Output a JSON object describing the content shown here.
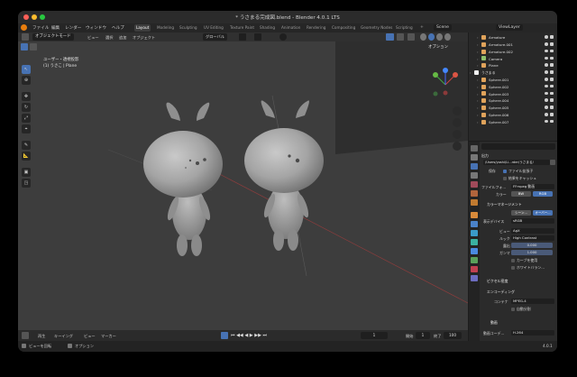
{
  "window": {
    "title": "* うさまる完成図.blend - Blender 4.0.1 LTS"
  },
  "menu": {
    "items": [
      "ファイル",
      "編集",
      "レンダー",
      "ウィンドウ",
      "ヘルプ"
    ]
  },
  "workspaces": {
    "tabs": [
      "Layout",
      "Modeling",
      "Sculpting",
      "UV Editing",
      "Texture Paint",
      "Shading",
      "Animation",
      "Rendering",
      "Compositing",
      "Geometry Nodes",
      "Scripting"
    ],
    "active": "Layout"
  },
  "scene_selector": {
    "scene": "Scene",
    "view_layer": "ViewLayer"
  },
  "viewport_header": {
    "mode": "オブジェクトモード",
    "menu_items": [
      "ビュー",
      "選択",
      "追加",
      "オブジェクト"
    ],
    "transform_orientation": "グローバル",
    "options_label": "オプション"
  },
  "viewport": {
    "view_name": "ユーザー・透視投影",
    "collection_path": "(1) うさこ | Plane"
  },
  "outliner": {
    "rows": [
      {
        "name": "Armature",
        "color": "#e0a35b",
        "indent": 1
      },
      {
        "name": "Armature.001",
        "color": "#e0a35b",
        "indent": 1
      },
      {
        "name": "Armature.002",
        "color": "#e0a35b",
        "indent": 1
      },
      {
        "name": "Camera",
        "color": "#8ec06c",
        "indent": 1
      },
      {
        "name": "Plane",
        "color": "#e0a35b",
        "indent": 1
      },
      {
        "name": "うさまる",
        "color": "#f2f2f2",
        "indent": 0
      },
      {
        "name": "Sphere.001",
        "color": "#e0a35b",
        "indent": 1
      },
      {
        "name": "Sphere.002",
        "color": "#e0a35b",
        "indent": 1
      },
      {
        "name": "Sphere.003",
        "color": "#e0a35b",
        "indent": 1
      },
      {
        "name": "Sphere.004",
        "color": "#e0a35b",
        "indent": 1
      },
      {
        "name": "Sphere.005",
        "color": "#e0a35b",
        "indent": 1
      },
      {
        "name": "Sphere.006",
        "color": "#e0a35b",
        "indent": 1
      },
      {
        "name": "Sphere.007",
        "color": "#e0a35b",
        "indent": 1
      }
    ]
  },
  "properties": {
    "output_section": "出力",
    "output_path": "/Users/yoshi/Li...rder/うさまる/",
    "save_label": "保存",
    "file_extension": "ファイル拡張子",
    "cache_result": "結果をキャッシュ",
    "file_format_label": "ファイルフォ...",
    "file_format_value": "FFmpeg 動画",
    "color_label": "カラー",
    "color_bw": "BW",
    "color_rgb": "RGB",
    "color_mgmt_section": "カラーマネージメント",
    "follow_scene": "シーン...",
    "override": "オーバー...",
    "display_device_label": "表示デバイス",
    "display_device_value": "sRGB",
    "view_label": "ビュー",
    "view_value": "AgX",
    "look_label": "ルック",
    "look_value": "High Contrast",
    "exposure_label": "露出",
    "exposure_value": "0.000",
    "gamma_label": "ガンマ",
    "gamma_value": "1.000",
    "use_curves": "カーブを使用",
    "white_balance": "ホワイトバラン...",
    "pixel_density_section": "ピクセル密度",
    "encoding_section": "エンコーディング",
    "container_label": "コンテナ",
    "container_value": "MPEG-4",
    "autosplit": "自動分割",
    "video_section": "動画",
    "video_codec_label": "動画コーデ...",
    "video_codec_value": "H.264"
  },
  "timeline": {
    "playback": "再生",
    "keying": "キーイング",
    "view": "ビュー",
    "marker": "マーカー",
    "current_frame": "1",
    "start_label": "開始",
    "start_value": "1",
    "end_label": "終了",
    "end_value": "100"
  },
  "status_bar": {
    "rotate_view": "ビューを回転",
    "options": "オプション",
    "version": "4.0.1"
  },
  "colors": {
    "accent": "#4772b3",
    "viewport_bg": "#3d3d3d",
    "active_tab": "#3d3d3d"
  }
}
